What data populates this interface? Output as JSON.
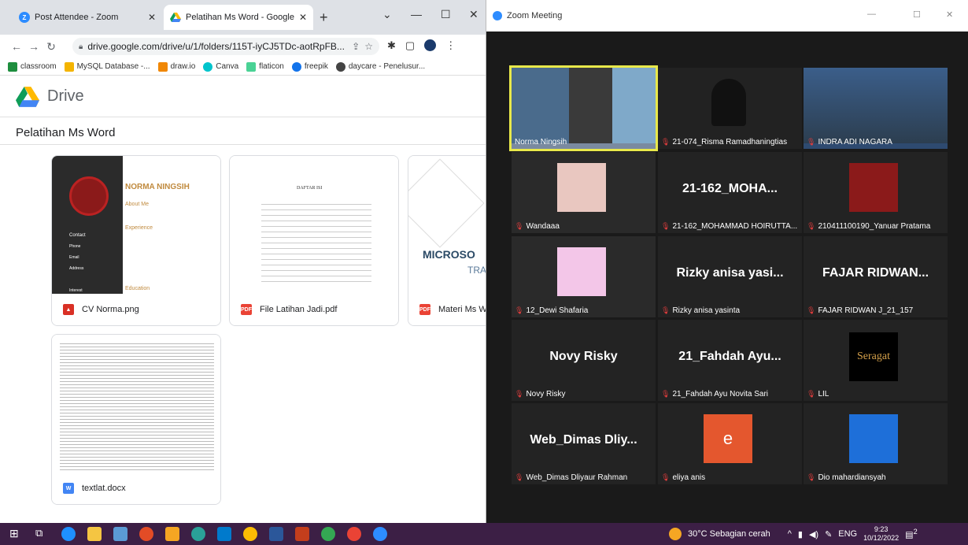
{
  "browser": {
    "tabs": [
      {
        "title": "Post Attendee - Zoom"
      },
      {
        "title": "Pelatihan Ms Word - Google Driv"
      }
    ],
    "new_tab": "+",
    "url": "drive.google.com/drive/u/1/folders/115T-iyCJ5TDc-aotRpFB...",
    "bookmarks": [
      "classroom",
      "MySQL Database -...",
      "draw.io",
      "Canva",
      "flaticon",
      "freepik",
      "daycare - Penelusur..."
    ]
  },
  "drive": {
    "app_name": "Drive",
    "folder_title": "Pelatihan Ms Word",
    "files": [
      {
        "name": "CV Norma.png",
        "type": "image",
        "thumb_title": "NORMA NINGSIH",
        "thumb_sections": [
          "About Me",
          "Experience",
          "Education",
          "Contact",
          "Phone",
          "Email",
          "Address",
          "Interest"
        ]
      },
      {
        "name": "File Latihan Jadi.pdf",
        "type": "pdf",
        "thumb_title": "DAFTAR ISI"
      },
      {
        "name": "Materi Ms W",
        "type": "pdf",
        "thumb_title": "MICROSO",
        "thumb_sub": "TRA"
      },
      {
        "name": "textlat.docx",
        "type": "docx"
      }
    ]
  },
  "zoom": {
    "window_title": "Zoom Meeting",
    "participants": [
      {
        "name": "Norma Ningsih",
        "display": "",
        "muted": false,
        "active": true
      },
      {
        "name": "21-074_Risma Ramadhaningtias",
        "display": "",
        "muted": true
      },
      {
        "name": "INDRA ADI NAGARA",
        "display": "",
        "muted": true
      },
      {
        "name": "Wandaaa",
        "display": "",
        "muted": true
      },
      {
        "name": "21-162_MOHAMMAD HOIRUTTA...",
        "display": "21-162_MOHA...",
        "muted": true
      },
      {
        "name": "210411100190_Yanuar Pratama",
        "display": "",
        "muted": true
      },
      {
        "name": "12_Dewi Shafaria",
        "display": "",
        "muted": true
      },
      {
        "name": "Rizky anisa yasinta",
        "display": "Rizky anisa yasi...",
        "muted": true
      },
      {
        "name": "FAJAR RIDWAN J_21_157",
        "display": "FAJAR RIDWAN...",
        "muted": true
      },
      {
        "name": "Novy Risky",
        "display": "Novy Risky",
        "muted": true
      },
      {
        "name": "21_Fahdah Ayu Novita Sari",
        "display": "21_Fahdah Ayu...",
        "muted": true
      },
      {
        "name": "LIL",
        "display": "",
        "muted": true
      },
      {
        "name": "Web_Dimas Dliyaur Rahman",
        "display": "Web_Dimas Dliy...",
        "muted": true
      },
      {
        "name": "eliya anis",
        "display": "",
        "avatar_letter": "e",
        "muted": true
      },
      {
        "name": "Dio mahardiansyah",
        "display": "",
        "muted": true
      }
    ],
    "lil_logo_text": "Seragat"
  },
  "taskbar": {
    "weather": "30°C  Sebagian cerah",
    "lang": "ENG",
    "time": "9:23",
    "date": "10/12/2022",
    "notif_count": "2"
  },
  "colors": {
    "zoom_blue": "#2d8cff",
    "taskbar": "#3c1f45",
    "active_speaker": "#e8e84a",
    "mute_red": "#e23d3d"
  }
}
